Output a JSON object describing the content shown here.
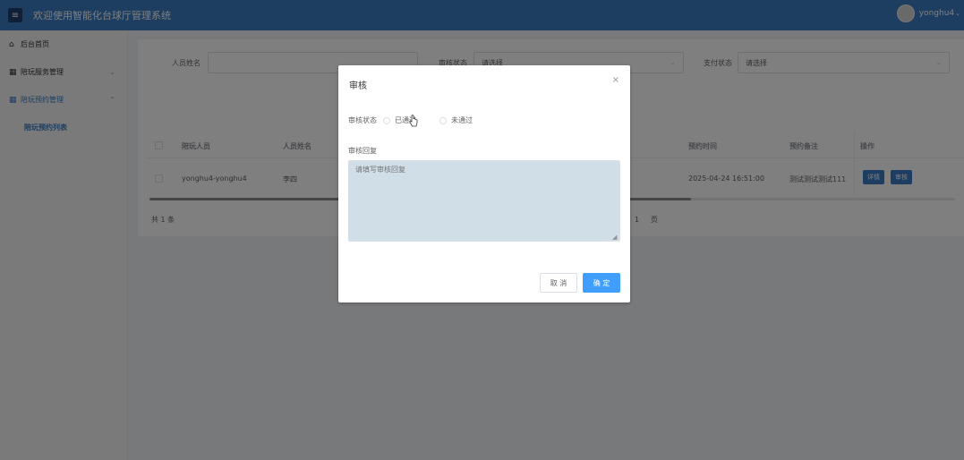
{
  "header": {
    "menu_icon": "menu-icon",
    "title": "欢迎使用智能化台球厅管理系统",
    "username": "yonghu4",
    "caret": "⌄"
  },
  "sidebar": {
    "items": [
      {
        "icon": "home-icon",
        "label": "后台首页"
      },
      {
        "icon": "grid-icon",
        "label": "陪玩服务管理",
        "arrow": "⌄"
      },
      {
        "icon": "grid-icon",
        "label": "陪玩预约管理",
        "arrow": "⌃"
      },
      {
        "label": "陪玩预约列表"
      }
    ]
  },
  "filters": {
    "person_name_label": "人员姓名",
    "person_name_value": "",
    "audit_status_label": "审核状态",
    "audit_status_value": "请选择",
    "pay_status_label": "支付状态",
    "pay_status_value": "请选择"
  },
  "table": {
    "headers": [
      "陪玩人员",
      "人员姓名",
      "预约时间",
      "预约备注",
      "操作"
    ],
    "rows": [
      {
        "companion": "yonghu4-yonghu4",
        "name": "李四",
        "time": "2025-04-24 16:51:00",
        "remark": "测试测试测试111",
        "btn_detail": "详情",
        "btn_audit": "审核"
      }
    ],
    "total": "共 1 条",
    "page": "1",
    "page_unit": "页"
  },
  "dialog": {
    "title": "审核",
    "close": "×",
    "status_label": "审核状态",
    "options": [
      "已通过",
      "未通过"
    ],
    "reply_label": "审核回复",
    "reply_placeholder": "请填写审核回复",
    "cancel": "取 消",
    "confirm": "确 定"
  },
  "colors": {
    "header": "#3a7cc3",
    "primary": "#409eff",
    "textarea_bg": "#cfdee7"
  }
}
